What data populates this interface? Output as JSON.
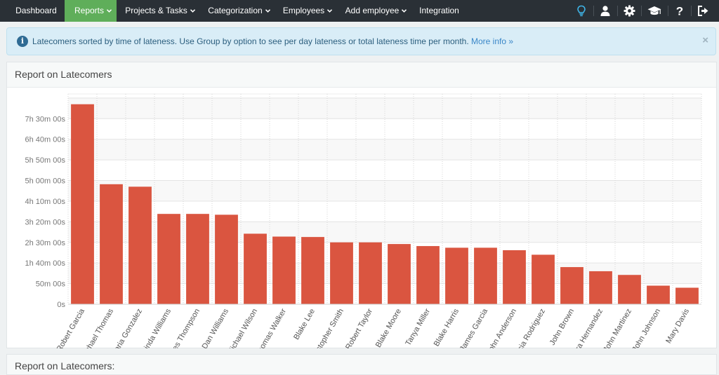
{
  "nav": {
    "items": [
      {
        "label": "Dashboard",
        "dropdown": false
      },
      {
        "label": "Reports",
        "dropdown": true
      },
      {
        "label": "Projects & Tasks",
        "dropdown": true
      },
      {
        "label": "Categorization",
        "dropdown": true
      },
      {
        "label": "Employees",
        "dropdown": true
      },
      {
        "label": "Add employee",
        "dropdown": true
      },
      {
        "label": "Integration",
        "dropdown": false
      }
    ],
    "active": "Reports",
    "icons": [
      "lightbulb-icon",
      "user-icon",
      "gear-icon",
      "graduation-cap-icon",
      "question-icon",
      "logout-icon"
    ],
    "colors": {
      "bar": "#2a3036",
      "active": "#5fae5a",
      "lightbulb": "#3fb5e8"
    }
  },
  "alert": {
    "text": "Latecomers sorted by time of lateness. Use Group by option to see per day lateness or total lateness time per month.",
    "link": "More info »",
    "close": "×"
  },
  "panel": {
    "title": "Report on Latecomers"
  },
  "panel2": {
    "title": "Report on Latecomers:"
  },
  "chart_data": {
    "type": "bar",
    "bar_color": "#da5540",
    "y_ticks": [
      "0s",
      "50m 00s",
      "1h 40m 00s",
      "2h 30m 00s",
      "3h 20m 00s",
      "4h 10m 00s",
      "5h 00m 00s",
      "5h 50m 00s",
      "6h 40m 00s",
      "7h 30m 00s"
    ],
    "ylim_minutes": [
      0,
      510
    ],
    "categories": [
      "Robert Garcia",
      "Michael Thomas",
      "Maria Gonzalez",
      "Linda Williams",
      "Charles Thompson",
      "Dan Williams",
      "Michael Wilson",
      "Thomas Walker",
      "Blake Lee",
      "Christopher Smith",
      "Robert Taylor",
      "Blake Moore",
      "Tanya Miller",
      "Blake Harris",
      "James Garcia",
      "John Anderson",
      "Patricia Rodriguez",
      "John Brown",
      "Barbara Hernandez",
      "John Martinez",
      "John Johnson",
      "Mary Davis"
    ],
    "values_minutes": [
      485,
      291,
      285,
      219,
      219,
      217,
      171,
      164,
      163,
      150,
      150,
      146,
      141,
      137,
      137,
      131,
      120,
      90,
      80,
      71,
      45,
      40
    ],
    "grid": true
  }
}
